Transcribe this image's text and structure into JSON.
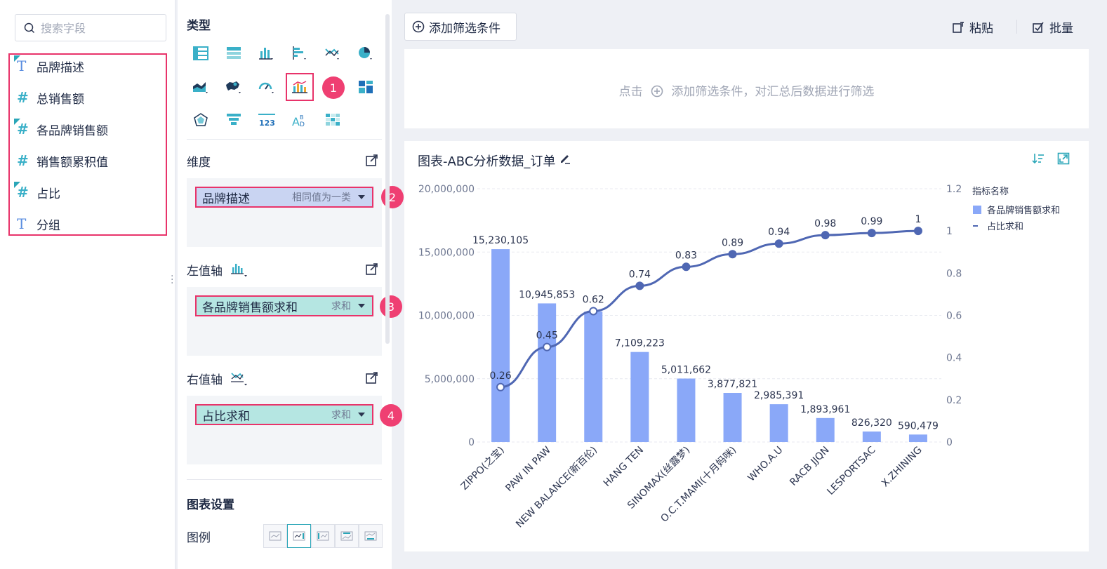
{
  "field_panel": {
    "search_placeholder": "搜索字段",
    "fields": [
      {
        "type": "T",
        "label": "品牌描述",
        "checked": true
      },
      {
        "type": "#",
        "label": "总销售额",
        "checked": false
      },
      {
        "type": "#",
        "label": "各品牌销售额",
        "checked": true
      },
      {
        "type": "#",
        "label": "销售额累积值",
        "checked": false
      },
      {
        "type": "#",
        "label": "占比",
        "checked": true
      },
      {
        "type": "T",
        "label": "分组",
        "checked": false
      }
    ]
  },
  "config": {
    "type_title": "类型",
    "dimension_label": "维度",
    "left_axis_label": "左值轴",
    "right_axis_label": "右值轴",
    "chart_settings_title": "图表设置",
    "legend_label": "图例",
    "dimension_pill": {
      "label": "品牌描述",
      "agg": "相同值为一类"
    },
    "left_axis_pill": {
      "label": "各品牌销售额求和",
      "agg": "求和"
    },
    "right_axis_pill": {
      "label": "占比求和",
      "agg": "求和"
    },
    "badges": [
      "1",
      "2",
      "3",
      "4"
    ]
  },
  "toolbar": {
    "add_filter": "添加筛选条件",
    "paste": "粘贴",
    "batch": "批量",
    "filter_hint_pre": "点击",
    "filter_hint_post": "添加筛选条件，对汇总后数据进行筛选"
  },
  "chart_card": {
    "title": "图表-ABC分析数据_订单"
  },
  "colors": {
    "bar": "#8aa8f8",
    "line": "#4f67b3",
    "accent": "#2aa6b8",
    "highlight": "#e8336a"
  },
  "chart_data": {
    "type": "bar",
    "categories": [
      "ZIPPO(之宝)",
      "PAW IN PAW",
      "NEW BALANCE(新百伦)",
      "HANG TEN",
      "SINOMAX(丝露梦)",
      "O.C.T.MAMI(十月妈咪)",
      "WHO.A.U",
      "RACB JJQN",
      "LESPORTSAC",
      "X.ZHINING"
    ],
    "series": [
      {
        "name": "各品牌销售额求和",
        "type": "bar",
        "axis": "left",
        "values": [
          15230105,
          10945853,
          10300000,
          7109223,
          5011662,
          3877821,
          2985391,
          1893961,
          826320,
          590479
        ],
        "labels": [
          "15,230,105",
          "10,945,853",
          "",
          "7,109,223",
          "5,011,662",
          "3,877,821",
          "2,985,391",
          "1,893,961",
          "826,320",
          "590,479"
        ]
      },
      {
        "name": "占比求和",
        "type": "line",
        "axis": "right",
        "values": [
          0.26,
          0.45,
          0.62,
          0.74,
          0.83,
          0.89,
          0.94,
          0.98,
          0.99,
          1
        ],
        "labels": [
          "0.26",
          "0.45",
          "0.62",
          "0.74",
          "0.83",
          "0.89",
          "0.94",
          "0.98",
          "0.99",
          "1"
        ]
      }
    ],
    "left_axis": {
      "ticks": [
        "0",
        "5,000,000",
        "10,000,000",
        "15,000,000",
        "20,000,000"
      ],
      "ylim": [
        0,
        20000000
      ]
    },
    "right_axis": {
      "ticks": [
        "0",
        "0.2",
        "0.4",
        "0.6",
        "0.8",
        "1",
        "1.2"
      ],
      "ylim": [
        0,
        1.2
      ]
    },
    "legend_title": "指标名称",
    "legend_position": "top-right",
    "grid": true
  }
}
